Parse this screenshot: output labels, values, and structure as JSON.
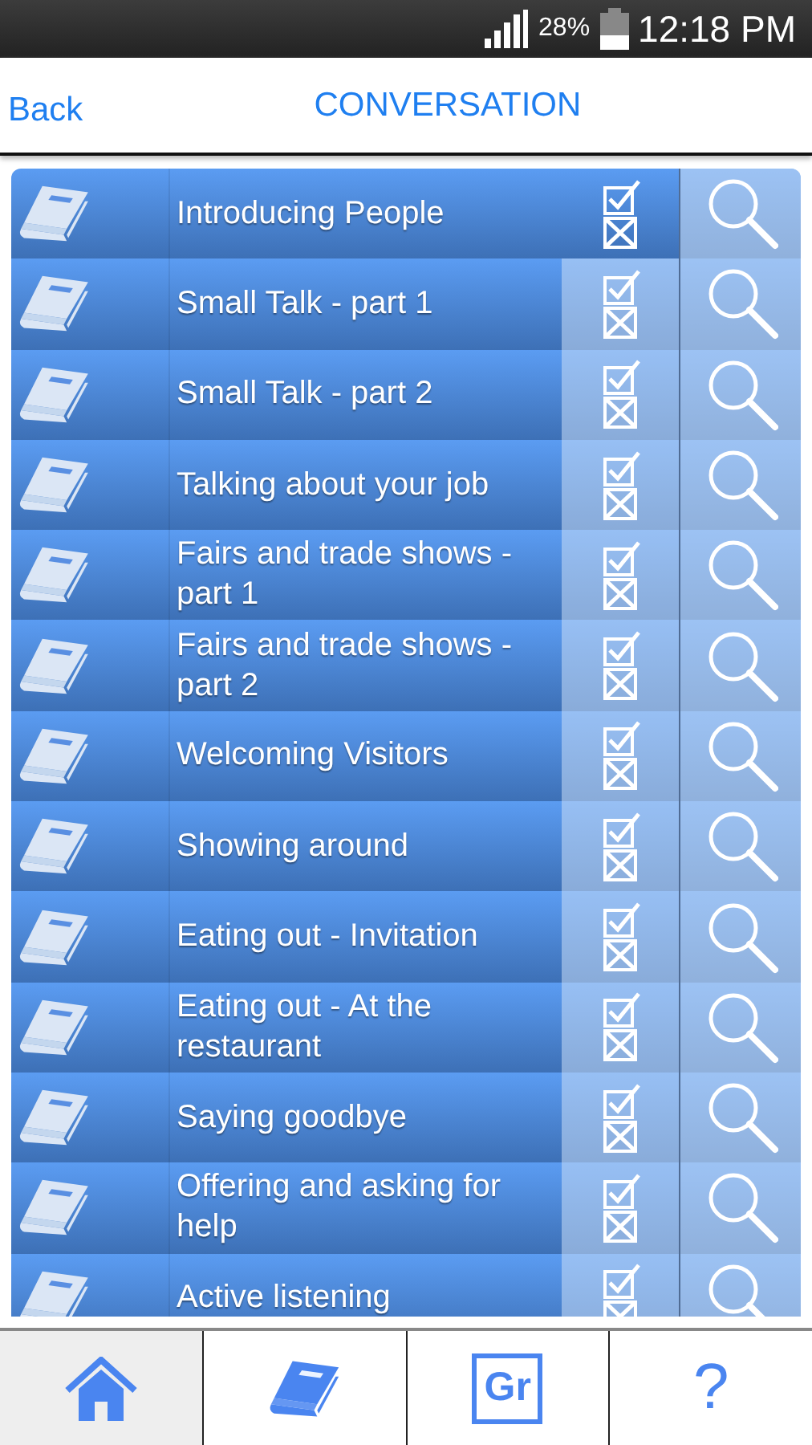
{
  "status_bar": {
    "battery": "28%",
    "time": "12:18 PM"
  },
  "header": {
    "back": "Back",
    "title": "CONVERSATION"
  },
  "lessons": [
    {
      "title": "Introducing People",
      "selected": true
    },
    {
      "title": "Small Talk - part 1",
      "selected": false
    },
    {
      "title": "Small Talk - part 2",
      "selected": false
    },
    {
      "title": "Talking about your job",
      "selected": false
    },
    {
      "title": "Fairs and trade shows - part 1",
      "selected": false
    },
    {
      "title": "Fairs and trade shows - part 2",
      "selected": false
    },
    {
      "title": "Welcoming Visitors",
      "selected": false
    },
    {
      "title": "Showing around",
      "selected": false
    },
    {
      "title": "Eating out - Invitation",
      "selected": false
    },
    {
      "title": "Eating out - At the restaurant",
      "selected": false
    },
    {
      "title": "Saying goodbye",
      "selected": false
    },
    {
      "title": "Offering and asking for help",
      "selected": false
    },
    {
      "title": "Active listening",
      "selected": false
    }
  ],
  "tabs": [
    {
      "kind": "home",
      "selected": true
    },
    {
      "kind": "book",
      "selected": false
    },
    {
      "kind": "boxed-text",
      "label": "Gr",
      "selected": false
    },
    {
      "kind": "text",
      "label": "?",
      "selected": false
    }
  ]
}
